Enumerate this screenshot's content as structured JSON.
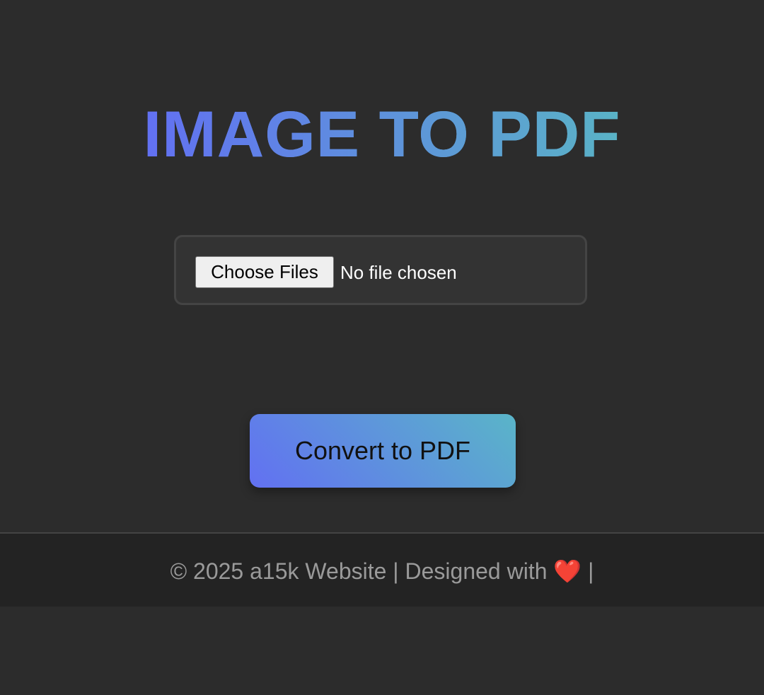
{
  "header": {
    "title": "IMAGE TO PDF"
  },
  "upload": {
    "choose_label": "Choose Files",
    "status_text": "No file chosen"
  },
  "actions": {
    "convert_label": "Convert to PDF"
  },
  "footer": {
    "text_before": "© 2025 a15k Website | Designed with ",
    "heart": "❤️",
    "text_after": " |"
  },
  "colors": {
    "background": "#2c2c2c",
    "gradient_start": "#6270f2",
    "gradient_end": "#5ab5c8",
    "footer_bg": "#232323",
    "footer_text": "#9a9a9a"
  }
}
